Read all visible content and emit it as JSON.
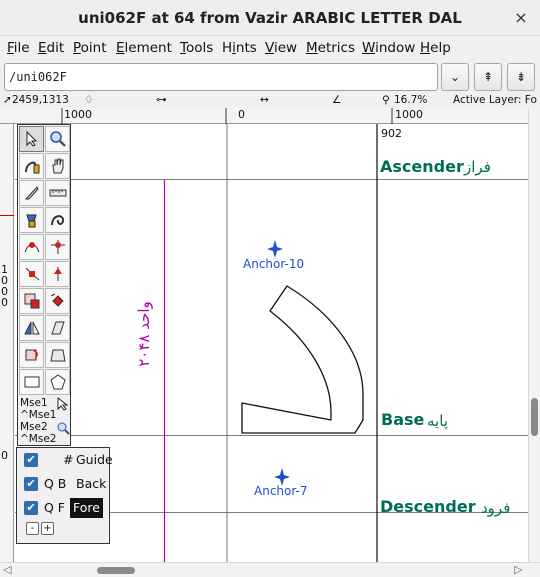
{
  "window": {
    "title": "uni062F at 64 from Vazir ARABIC LETTER DAL",
    "close_glyph": "×"
  },
  "menu": [
    {
      "label": "File",
      "u": "F",
      "rest": "ile"
    },
    {
      "label": "Edit",
      "u": "E",
      "rest": "dit"
    },
    {
      "label": "Point",
      "u": "P",
      "rest": "oint"
    },
    {
      "label": "Element",
      "u": "E",
      "rest": "lement"
    },
    {
      "label": "Tools",
      "u": "T",
      "rest": "ools"
    },
    {
      "label": "Hints",
      "pre": "H",
      "u": "i",
      "rest": "nts"
    },
    {
      "label": "View",
      "u": "V",
      "rest": "iew"
    },
    {
      "label": "Metrics",
      "u": "M",
      "rest": "etrics"
    },
    {
      "label": "Window",
      "u": "W",
      "rest": "indow"
    },
    {
      "label": "Help",
      "u": "H",
      "rest": "elp"
    }
  ],
  "glyph_field": {
    "value": "/uni062F"
  },
  "glyph_buttons": {
    "dropdown": "⌄",
    "prev": "⇞",
    "next": "⇟"
  },
  "info": {
    "cursor": "2459,1313",
    "zoom": "16.7%",
    "active_layer": "Active Layer: Fo"
  },
  "ruler": {
    "top": [
      "1000",
      "0",
      "1000"
    ],
    "left": [
      "1",
      "0",
      "0",
      "0"
    ]
  },
  "canvas": {
    "ascender_value": "902",
    "ascender_label": "Ascender",
    "ascender_arabic": "فراز",
    "base_label": "Base",
    "base_arabic": "پایه",
    "descender_label": "Descender",
    "descender_arabic": "فرود",
    "width_label": "۲۰۴۸ واحد",
    "anchor1": "Anchor-10",
    "anchor2": "Anchor-7"
  },
  "tools_mouse": [
    "Mse1",
    "^Mse1",
    "Mse2",
    "^Mse2"
  ],
  "layers": [
    {
      "prefix": "#",
      "label": "Guide",
      "checked": true
    },
    {
      "prefix": "Q B",
      "label": "Back",
      "checked": true
    },
    {
      "prefix": "Q F",
      "label": "Fore",
      "checked": true
    }
  ],
  "layer_buttons": {
    "remove": "-",
    "add": "+"
  },
  "scroll_arrows": {
    "left": "◁",
    "right": "▷"
  },
  "colors": {
    "guide_green": "#006e55",
    "width_magenta": "#b000b0",
    "anchor_blue": "#1f4fcf",
    "outline": "#111111"
  }
}
